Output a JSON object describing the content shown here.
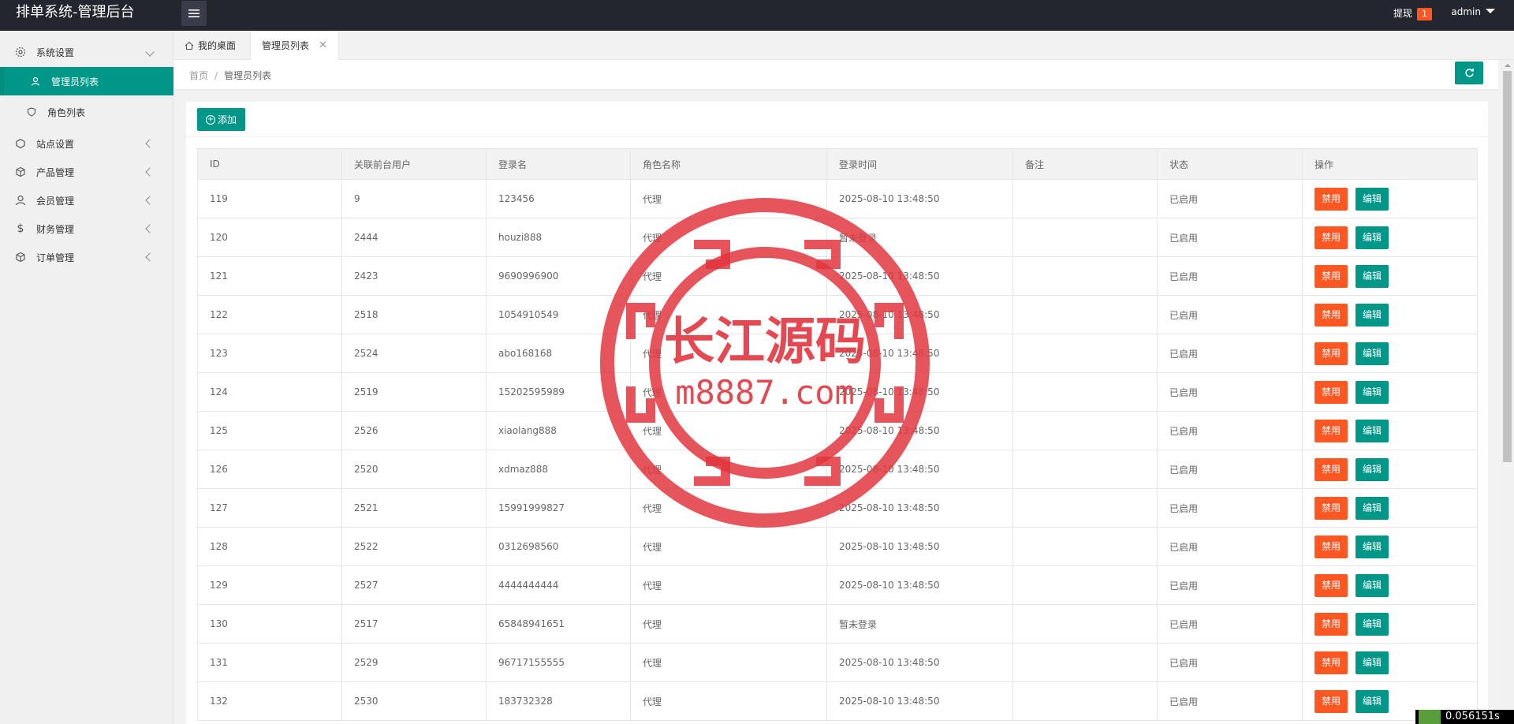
{
  "header": {
    "title": "排单系统-管理后台",
    "withdraw_label": "提现",
    "withdraw_count": "1",
    "user": "admin"
  },
  "sidebar": {
    "items": [
      {
        "label": "系统设置",
        "icon": "gear-icon"
      },
      {
        "label": "管理员列表",
        "icon": "user-icon"
      },
      {
        "label": "角色列表",
        "icon": "shield-icon"
      },
      {
        "label": "站点设置",
        "icon": "globe-icon"
      },
      {
        "label": "产品管理",
        "icon": "box-icon"
      },
      {
        "label": "会员管理",
        "icon": "member-icon"
      },
      {
        "label": "财务管理",
        "icon": "dollar-icon"
      },
      {
        "label": "订单管理",
        "icon": "order-icon"
      }
    ]
  },
  "tabs": {
    "home": "我的桌面",
    "current": "管理员列表",
    "close": "✕"
  },
  "breadcrumb": {
    "home": "首页",
    "sep": "/",
    "current": "管理员列表"
  },
  "toolbar": {
    "add_label": "添加"
  },
  "table": {
    "headers": [
      "ID",
      "关联前台用户",
      "登录名",
      "角色名称",
      "登录时间",
      "备注",
      "状态",
      "操作"
    ],
    "rows": [
      [
        "119",
        "9",
        "123456",
        "代理",
        "2025-08-10 13:48:50",
        "",
        "已启用"
      ],
      [
        "120",
        "2444",
        "houzi888",
        "代理",
        "暂未登录",
        "",
        "已启用"
      ],
      [
        "121",
        "2423",
        "9690996900",
        "代理",
        "2025-08-10 13:48:50",
        "",
        "已启用"
      ],
      [
        "122",
        "2518",
        "1054910549",
        "代理",
        "2025-08-10 13:48:50",
        "",
        "已启用"
      ],
      [
        "123",
        "2524",
        "abo168168",
        "代理",
        "2025-08-10 13:48:50",
        "",
        "已启用"
      ],
      [
        "124",
        "2519",
        "15202595989",
        "代理",
        "2025-08-10 13:48:50",
        "",
        "已启用"
      ],
      [
        "125",
        "2526",
        "xiaolang888",
        "代理",
        "2025-08-10 13:48:50",
        "",
        "已启用"
      ],
      [
        "126",
        "2520",
        "xdmaz888",
        "代理",
        "2025-08-10 13:48:50",
        "",
        "已启用"
      ],
      [
        "127",
        "2521",
        "15991999827",
        "代理",
        "2025-08-10 13:48:50",
        "",
        "已启用"
      ],
      [
        "128",
        "2522",
        "0312698560",
        "代理",
        "2025-08-10 13:48:50",
        "",
        "已启用"
      ],
      [
        "129",
        "2527",
        "4444444444",
        "代理",
        "2025-08-10 13:48:50",
        "",
        "已启用"
      ],
      [
        "130",
        "2517",
        "65848941651",
        "代理",
        "暂未登录",
        "",
        "已启用"
      ],
      [
        "131",
        "2529",
        "96717155555",
        "代理",
        "2025-08-10 13:48:50",
        "",
        "已启用"
      ],
      [
        "132",
        "2530",
        "183732328",
        "代理",
        "2025-08-10 13:48:50",
        "",
        "已启用"
      ]
    ],
    "disable_label": "禁用",
    "edit_label": "编辑"
  },
  "watermark": {
    "line1": "长江源码",
    "line2": "m8887.com"
  },
  "timer": "0.056151s",
  "colors": {
    "header_bg": "#23262e",
    "accent": "#009688",
    "danger": "#ff5722"
  }
}
